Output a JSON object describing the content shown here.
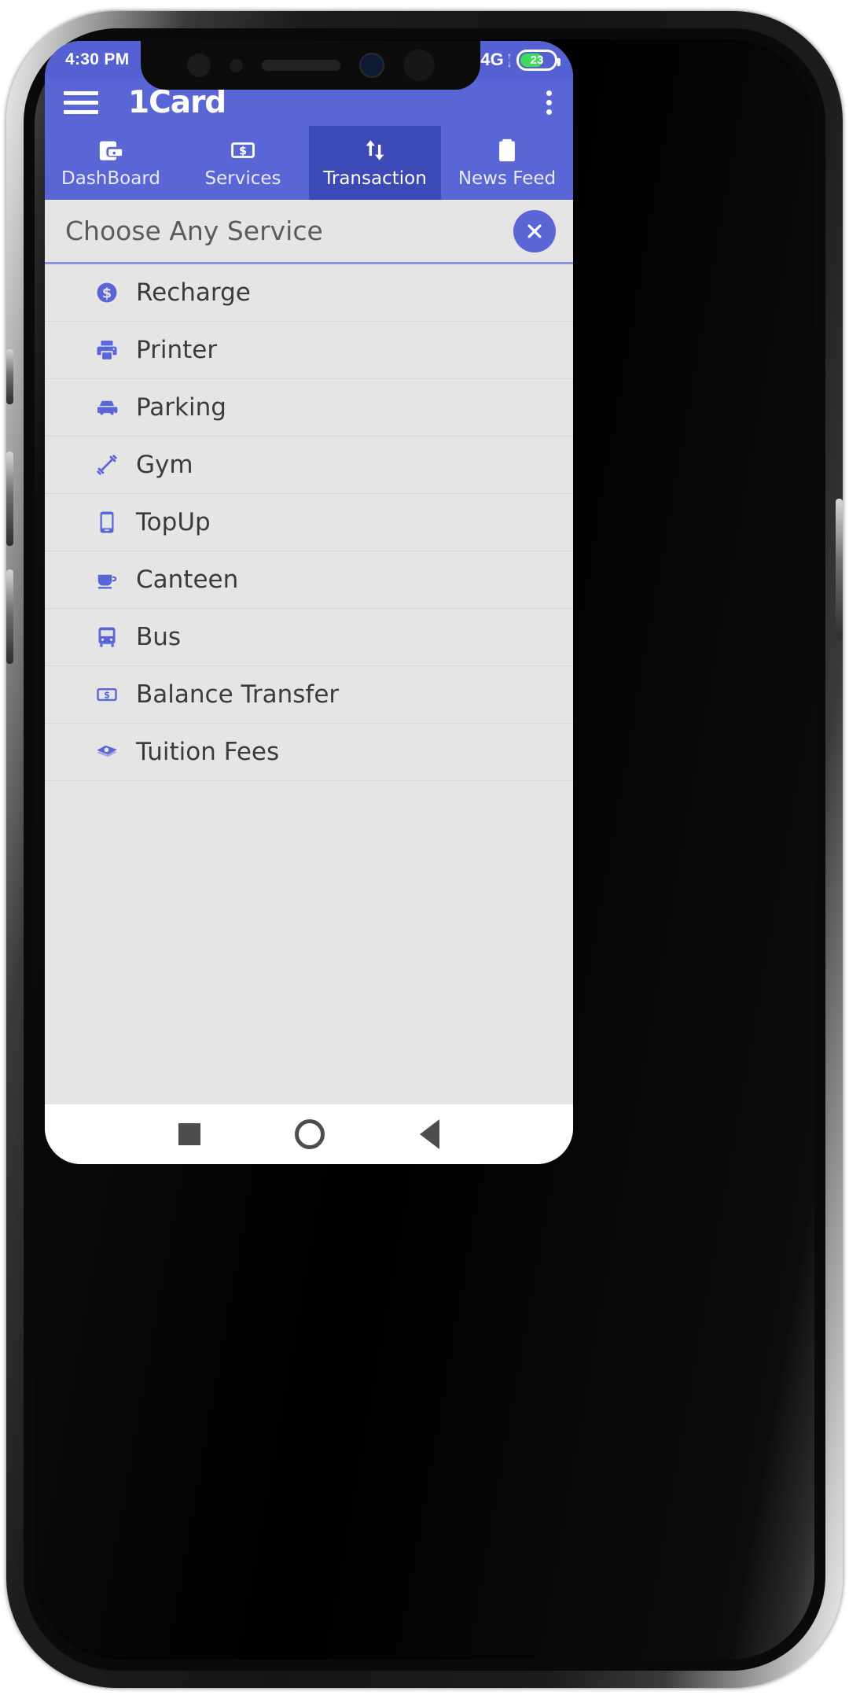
{
  "status_bar": {
    "time": "4:30 PM",
    "network_label": "4G",
    "battery_percent": "23",
    "signal_icon": "signal-bars-icon",
    "battery_icon": "battery-icon"
  },
  "app_bar": {
    "title": "1Card",
    "menu_icon": "hamburger-menu-icon",
    "overflow_icon": "more-vertical-icon"
  },
  "tabs": [
    {
      "label": "DashBoard",
      "icon": "wallet-card-icon",
      "active": false
    },
    {
      "label": "Services",
      "icon": "money-bill-icon",
      "active": false
    },
    {
      "label": "Transaction",
      "icon": "exchange-arrows-icon",
      "active": true
    },
    {
      "label": "News Feed",
      "icon": "clipboard-icon",
      "active": false
    }
  ],
  "search": {
    "value": "",
    "placeholder": "Choose Any Service",
    "clear_icon": "close-x-icon"
  },
  "services": [
    {
      "label": "Recharge",
      "icon": "dollar-circle-icon"
    },
    {
      "label": "Printer",
      "icon": "printer-icon"
    },
    {
      "label": "Parking",
      "icon": "car-icon"
    },
    {
      "label": "Gym",
      "icon": "dumbbell-icon"
    },
    {
      "label": "TopUp",
      "icon": "mobile-phone-icon"
    },
    {
      "label": "Canteen",
      "icon": "coffee-cup-icon"
    },
    {
      "label": "Bus",
      "icon": "bus-icon"
    },
    {
      "label": "Balance Transfer",
      "icon": "money-bill-icon"
    },
    {
      "label": "Tuition Fees",
      "icon": "money-stack-icon"
    }
  ],
  "nav_bar": {
    "recents_icon": "square-recents-icon",
    "home_icon": "circle-home-icon",
    "back_icon": "triangle-back-icon"
  },
  "colors": {
    "primary": "#5b66d6",
    "primary_dark": "#3c4ab8",
    "status_bar": "#5561d3",
    "screen_bg": "#e5e5e5",
    "icon_purple": "#5b66d6",
    "battery_green": "#3ddc5b"
  }
}
